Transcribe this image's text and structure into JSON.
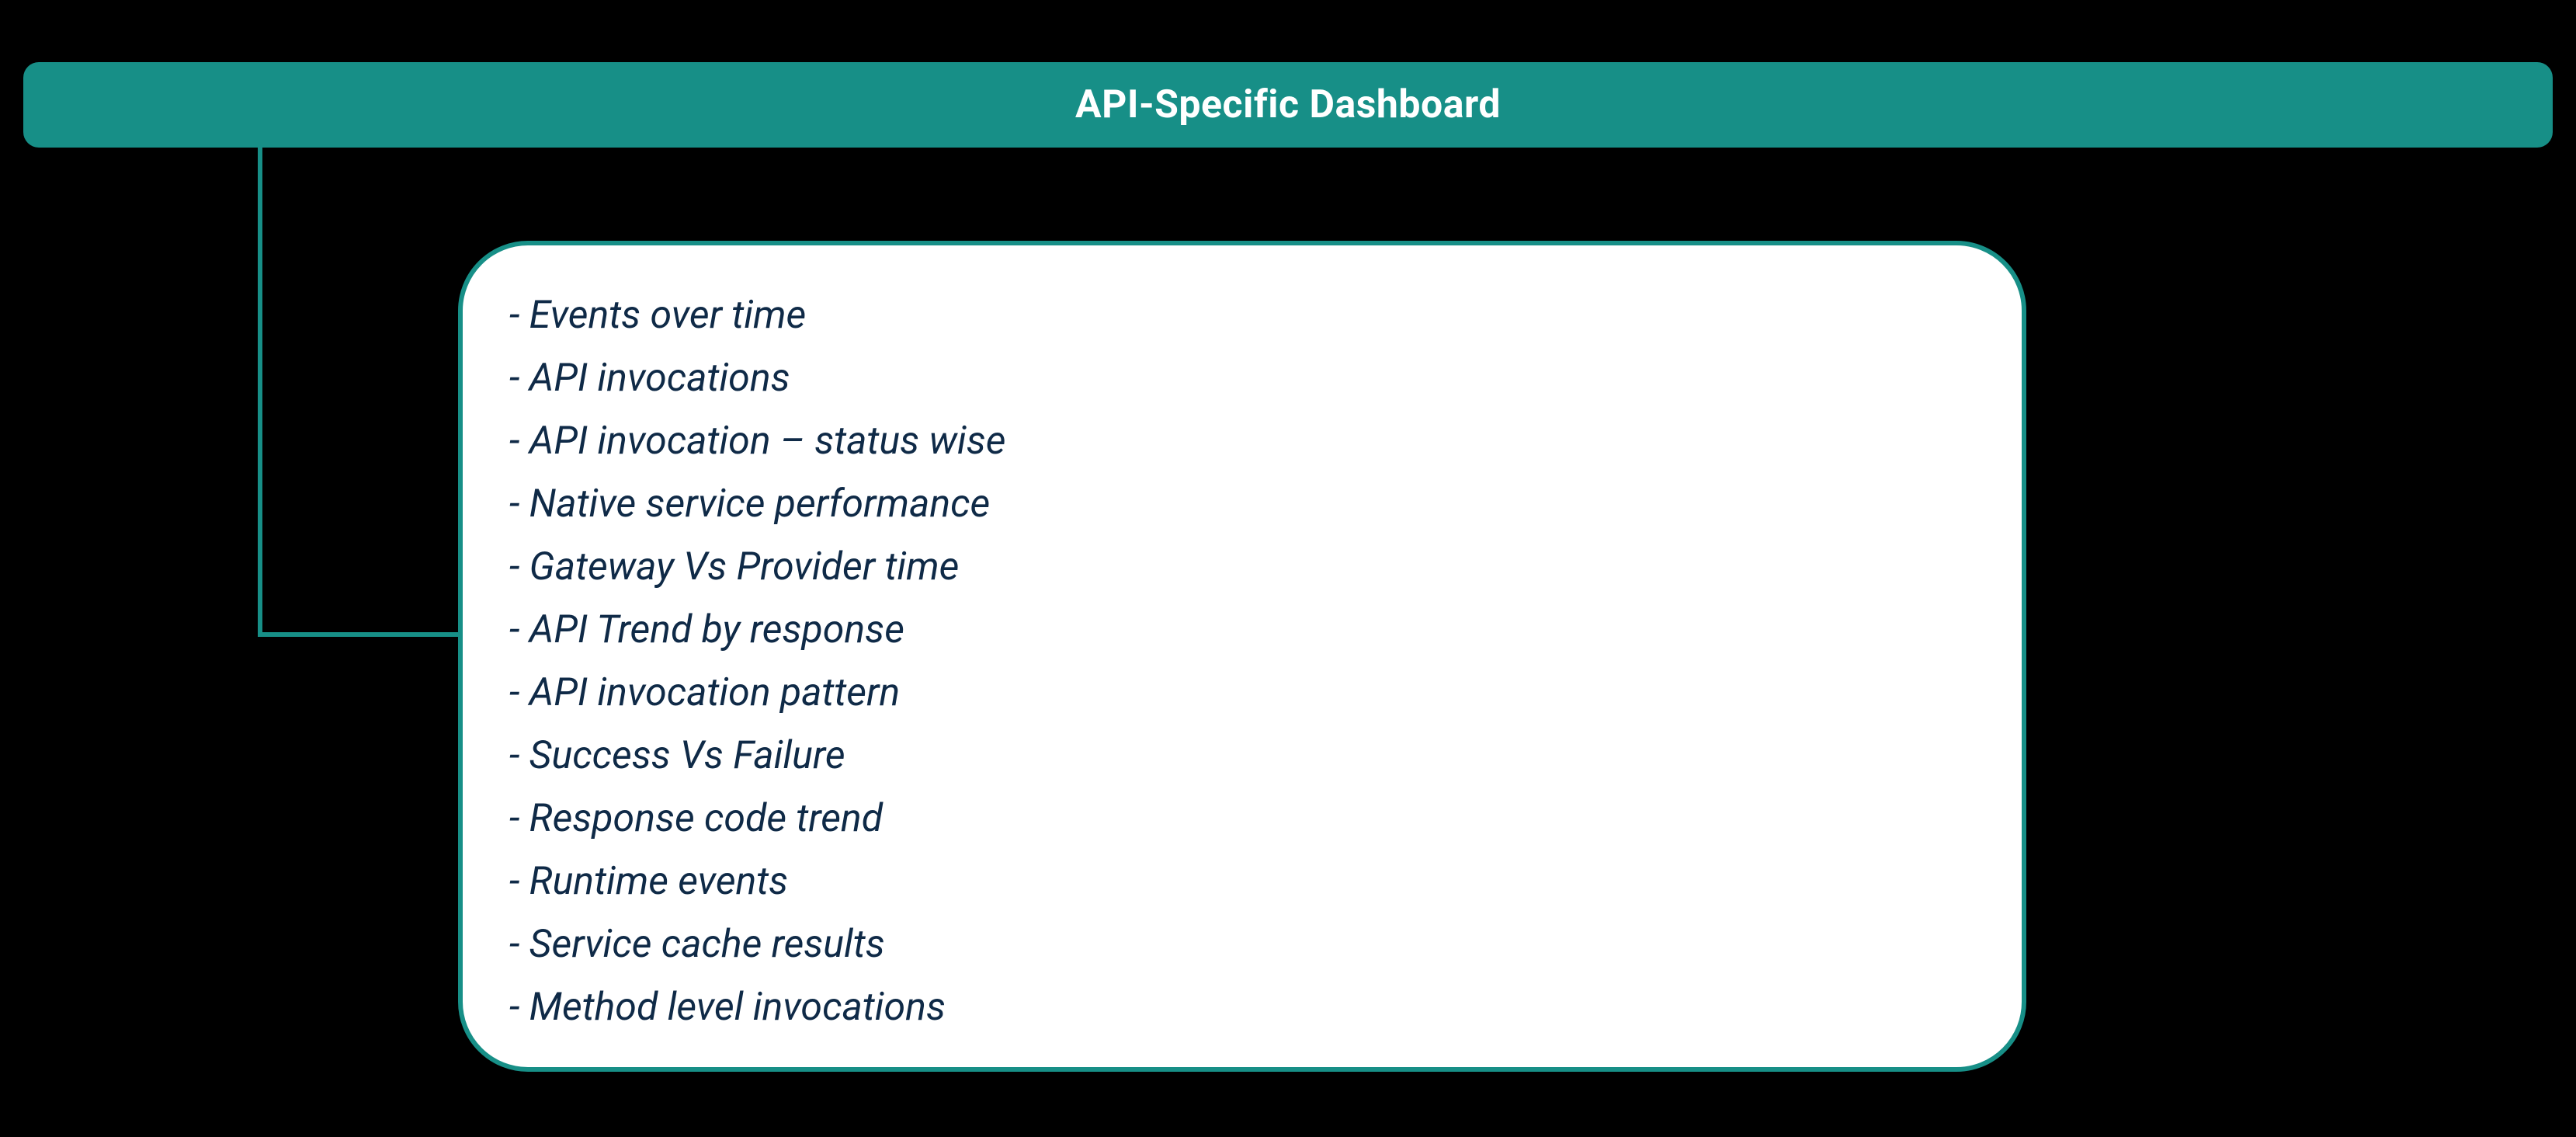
{
  "header": {
    "title": "API-Specific  Dashboard"
  },
  "items": [
    "- Events over time",
    "- API invocations",
    "- API invocation – status wise",
    "- Native service performance",
    "- Gateway Vs Provider time",
    "- API Trend by response",
    "- API invocation pattern",
    "- Success Vs Failure",
    "- Response code trend",
    "- Runtime events",
    "- Service cache results",
    "- Method level invocations"
  ]
}
